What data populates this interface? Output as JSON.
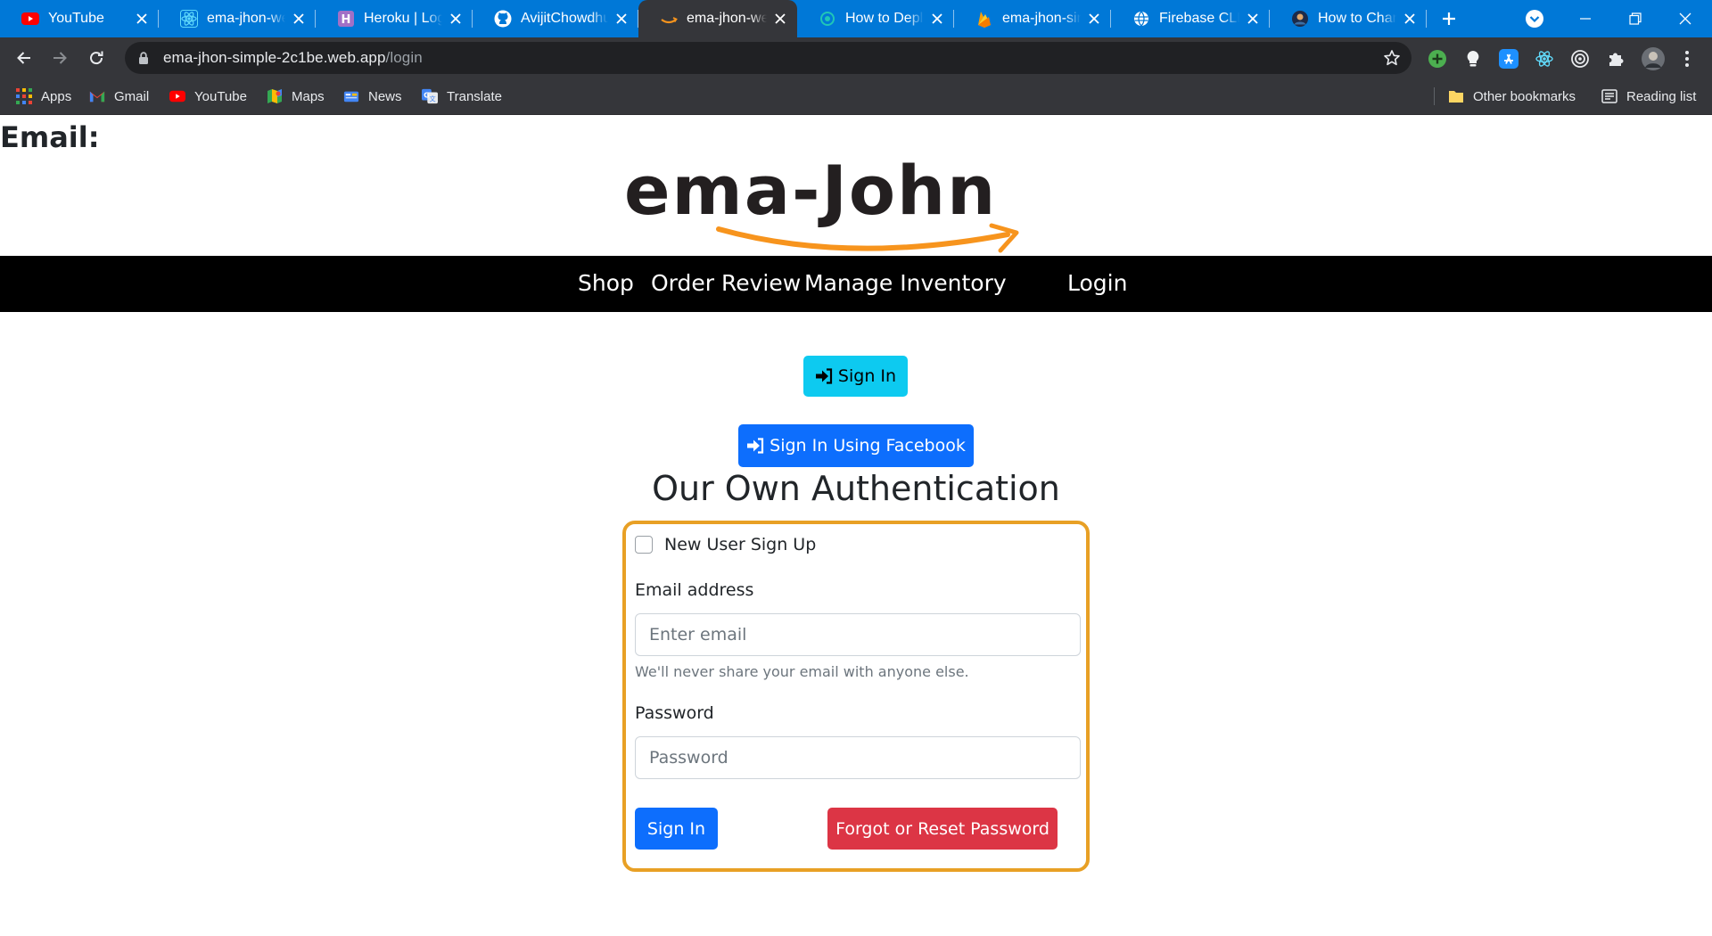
{
  "browser": {
    "tabs": [
      {
        "title": "YouTube",
        "icon": "youtube-icon"
      },
      {
        "title": "ema-jhon-web",
        "icon": "react-icon"
      },
      {
        "title": "Heroku | Login",
        "icon": "heroku-icon"
      },
      {
        "title": "AvijitChowdhury",
        "icon": "github-icon"
      },
      {
        "title": "ema-jhon-web",
        "icon": "amazon-icon",
        "active": true
      },
      {
        "title": "How to Deploy",
        "icon": "netlify-icon"
      },
      {
        "title": "ema-jhon-simple",
        "icon": "firebase-icon"
      },
      {
        "title": "Firebase CLI",
        "icon": "globe-icon"
      },
      {
        "title": "How to Change",
        "icon": "avatar-icon"
      }
    ],
    "url_host": "ema-jhon-simple-2c1be.web.app",
    "url_path": "/login",
    "bookmarks": [
      {
        "label": "Apps",
        "icon": "apps-grid-icon"
      },
      {
        "label": "Gmail",
        "icon": "gmail-icon"
      },
      {
        "label": "YouTube",
        "icon": "youtube-icon"
      },
      {
        "label": "Maps",
        "icon": "maps-icon"
      },
      {
        "label": "News",
        "icon": "news-icon"
      },
      {
        "label": "Translate",
        "icon": "translate-icon"
      }
    ],
    "other_bookmarks": "Other bookmarks",
    "reading_list": "Reading list",
    "colors": {
      "tabstrip": "#0078d7",
      "toolbar": "#35363a",
      "omnibox": "#202124"
    }
  },
  "page": {
    "email_heading": "Email:",
    "logo_text": "ema-John",
    "nav": {
      "shop": "Shop",
      "order_review": "Order Review",
      "manage_inventory": "Manage Inventory",
      "login": "Login"
    },
    "sign_in_button": "Sign In",
    "facebook_button": "Sign In Using Facebook",
    "auth_title": "Our Own Authentication",
    "form": {
      "new_user_label": "New User Sign Up",
      "email_label": "Email address",
      "email_placeholder": "Enter email",
      "email_help": "We'll never share your email with anyone else.",
      "password_label": "Password",
      "password_placeholder": "Password",
      "submit_label": "Sign In",
      "forgot_label": "Forgot or Reset Password"
    },
    "colors": {
      "nav_bg": "#000000",
      "info_button": "#0dcaf0",
      "primary_button": "#0d6efd",
      "danger_button": "#dc3545",
      "form_border": "#e8a025",
      "logo_smile": "#f7941d"
    }
  }
}
